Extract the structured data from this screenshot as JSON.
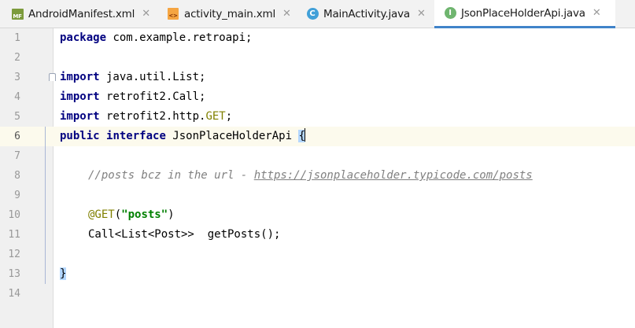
{
  "tabs": [
    {
      "label": "AndroidManifest.xml",
      "icon": "android-manifest-icon",
      "icon_text": "MF",
      "active": false
    },
    {
      "label": "activity_main.xml",
      "icon": "xml-layout-icon",
      "icon_text": "<>",
      "active": false
    },
    {
      "label": "MainActivity.java",
      "icon": "java-class-icon",
      "icon_text": "C",
      "active": false
    },
    {
      "label": "JsonPlaceHolderApi.java",
      "icon": "java-interface-icon",
      "icon_text": "I",
      "active": true
    }
  ],
  "close_glyph": "✕",
  "editor": {
    "current_line": 6,
    "lines": [
      {
        "number": "1"
      },
      {
        "number": "2"
      },
      {
        "number": "3"
      },
      {
        "number": "4"
      },
      {
        "number": "5"
      },
      {
        "number": "6"
      },
      {
        "number": "7"
      },
      {
        "number": "8"
      },
      {
        "number": "9"
      },
      {
        "number": "10"
      },
      {
        "number": "11"
      },
      {
        "number": "12"
      },
      {
        "number": "13"
      },
      {
        "number": "14"
      }
    ],
    "code": {
      "l1_kw": "package",
      "l1_rest": " com.example.retroapi;",
      "l3_kw": "import",
      "l3_rest": " java.util.List;",
      "l4_kw": "import",
      "l4_rest": " retrofit2.Call;",
      "l5_kw": "import",
      "l5_rest_a": " retrofit2.http.",
      "l5_ann": "GET",
      "l5_rest_b": ";",
      "l6_kw1": "public",
      "l6_kw2": "interface",
      "l6_name": " JsonPlaceHolderApi ",
      "l6_brace": "{",
      "l8_comment": "//posts bcz in the url - ",
      "l8_link": "https://jsonplaceholder.typicode.com/posts",
      "l10_ann": "@GET",
      "l10_open": "(",
      "l10_str": "\"posts\"",
      "l10_close": ")",
      "l11_text": "Call<List<Post>>  getPosts();",
      "l13_brace": "}"
    }
  },
  "colors": {
    "keyword": "#000080",
    "annotation": "#808000",
    "string": "#008000",
    "comment": "#808080",
    "active_tab_underline": "#4083c9",
    "current_line_bg": "#fcfaed"
  }
}
